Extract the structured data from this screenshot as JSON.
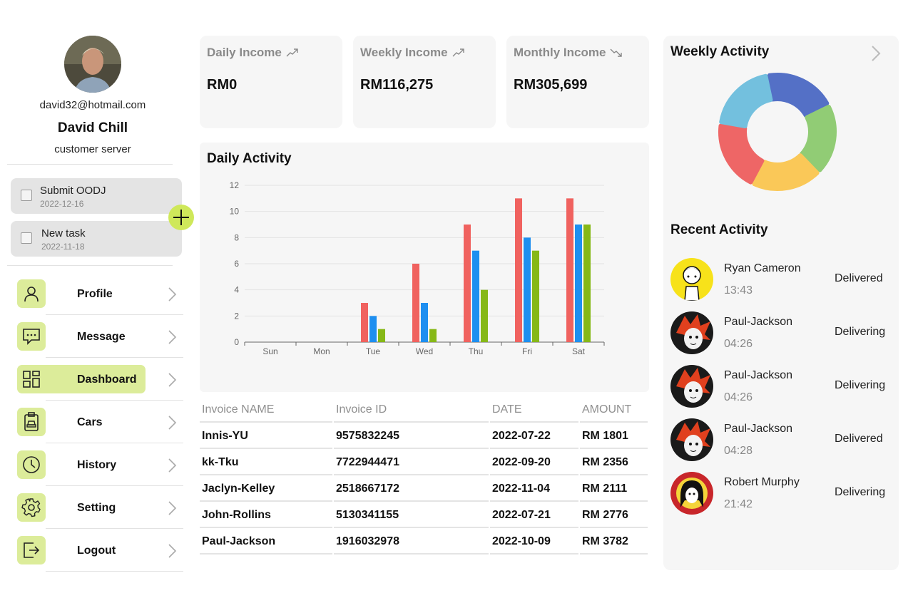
{
  "profile": {
    "email": "david32@hotmail.com",
    "name": "David Chill",
    "role": "customer server"
  },
  "tasks": [
    {
      "name": "Submit OODJ",
      "date": "2022-12-16"
    },
    {
      "name": "New task",
      "date": "2022-11-18"
    }
  ],
  "nav": [
    {
      "label": "Profile",
      "icon": "user-icon"
    },
    {
      "label": "Message",
      "icon": "message-icon"
    },
    {
      "label": "Dashboard",
      "icon": "dashboard-icon",
      "active": true
    },
    {
      "label": "Cars",
      "icon": "car-icon"
    },
    {
      "label": "History",
      "icon": "clock-icon"
    },
    {
      "label": "Setting",
      "icon": "gear-icon"
    },
    {
      "label": "Logout",
      "icon": "logout-icon"
    }
  ],
  "cards": [
    {
      "title": "Daily Income",
      "value": "RM0",
      "trend": "up"
    },
    {
      "title": "Weekly Income",
      "value": "RM116,275",
      "trend": "up"
    },
    {
      "title": "Monthly Income",
      "value": "RM305,699",
      "trend": "down"
    }
  ],
  "daily_activity": {
    "title": "Daily Activity"
  },
  "chart_data": [
    {
      "type": "bar",
      "title": "",
      "categories": [
        "Sun",
        "Mon",
        "Tue",
        "Wed",
        "Thu",
        "Fri",
        "Sat"
      ],
      "series": [
        {
          "values": [
            0,
            0,
            3,
            6,
            9,
            11,
            11
          ],
          "color": "#f0625f"
        },
        {
          "values": [
            0,
            0,
            2,
            3,
            7,
            8,
            9
          ],
          "color": "#1e8ff0"
        },
        {
          "values": [
            0,
            0,
            1,
            1,
            4,
            7,
            9
          ],
          "color": "#86b817"
        }
      ],
      "yticks": [
        0,
        2,
        4,
        6,
        8,
        10,
        12
      ],
      "ylim": [
        0,
        12
      ],
      "grid": true
    },
    {
      "type": "pie",
      "segments": [
        {
          "value": 1,
          "color": "#5470c6"
        },
        {
          "value": 1,
          "color": "#91cc75"
        },
        {
          "value": 1,
          "color": "#fac858"
        },
        {
          "value": 1,
          "color": "#ee6666"
        },
        {
          "value": 1,
          "color": "#73c0de"
        }
      ]
    }
  ],
  "invoices": {
    "headers": [
      "Invoice NAME",
      "Invoice ID",
      "DATE",
      "AMOUNT"
    ],
    "rows": [
      [
        "Innis-YU",
        "9575832245",
        "2022-07-22",
        "RM 1801"
      ],
      [
        "kk-Tku",
        "7722944471",
        "2022-09-20",
        "RM 2356"
      ],
      [
        "Jaclyn-Kelley",
        "2518667172",
        "2022-11-04",
        "RM 2111"
      ],
      [
        "John-Rollins",
        "5130341155",
        "2022-07-21",
        "RM 2776"
      ],
      [
        "Paul-Jackson",
        "1916032978",
        "2022-10-09",
        "RM 3782"
      ]
    ]
  },
  "weekly_activity": {
    "title": "Weekly Activity"
  },
  "recent_activity": {
    "title": "Recent Activity",
    "items": [
      {
        "name": "Ryan Cameron",
        "time": "13:43",
        "status": "Delivered"
      },
      {
        "name": "Paul-Jackson",
        "time": "04:26",
        "status": "Delivering"
      },
      {
        "name": "Paul-Jackson",
        "time": "04:26",
        "status": "Delivering"
      },
      {
        "name": "Paul-Jackson",
        "time": "04:28",
        "status": "Delivered"
      },
      {
        "name": "Robert Murphy",
        "time": "21:42",
        "status": "Delivering"
      }
    ]
  }
}
